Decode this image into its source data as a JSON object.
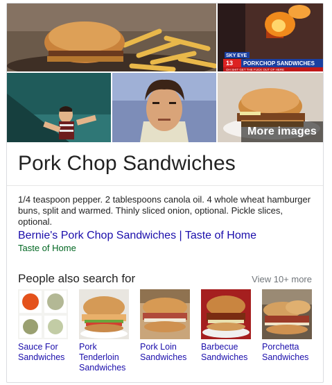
{
  "images": {
    "more_images_label": "More images",
    "news_caption": "PORKCHOP SANDWICHES",
    "news_channel": "13",
    "news_ticker": "OH SHIT GET THE FUCK OUT OF HERE",
    "news_eyewitness": "SKY EYE"
  },
  "entity": {
    "title": "Pork Chop Sandwiches",
    "description": "1/4 teaspoon pepper. 2 tablespoons canola oil. 4 whole wheat hamburger buns, split and warmed. Thinly sliced onion, optional. Pickle slices, optional.",
    "source_link": "Bernie's Pork Chop Sandwiches | Taste of Home",
    "source_site": "Taste of Home"
  },
  "people_also_search": {
    "heading": "People also search for",
    "view_more": "View 10+ more",
    "items": [
      {
        "label": "Sauce For Sandwiches",
        "icon": "sauce-collage"
      },
      {
        "label": "Pork Tenderloin Sandwiches",
        "icon": "tenderloin-sandwich"
      },
      {
        "label": "Pork Loin Sandwiches",
        "icon": "pork-loin-sandwich"
      },
      {
        "label": "Barbecue Sandwiches",
        "icon": "bbq-sandwich"
      },
      {
        "label": "Porchetta Sandwiches",
        "icon": "porchetta-sandwich"
      }
    ]
  },
  "colors": {
    "link": "#1a0dab",
    "site": "#006621",
    "muted": "#70757a",
    "text": "#222222"
  }
}
